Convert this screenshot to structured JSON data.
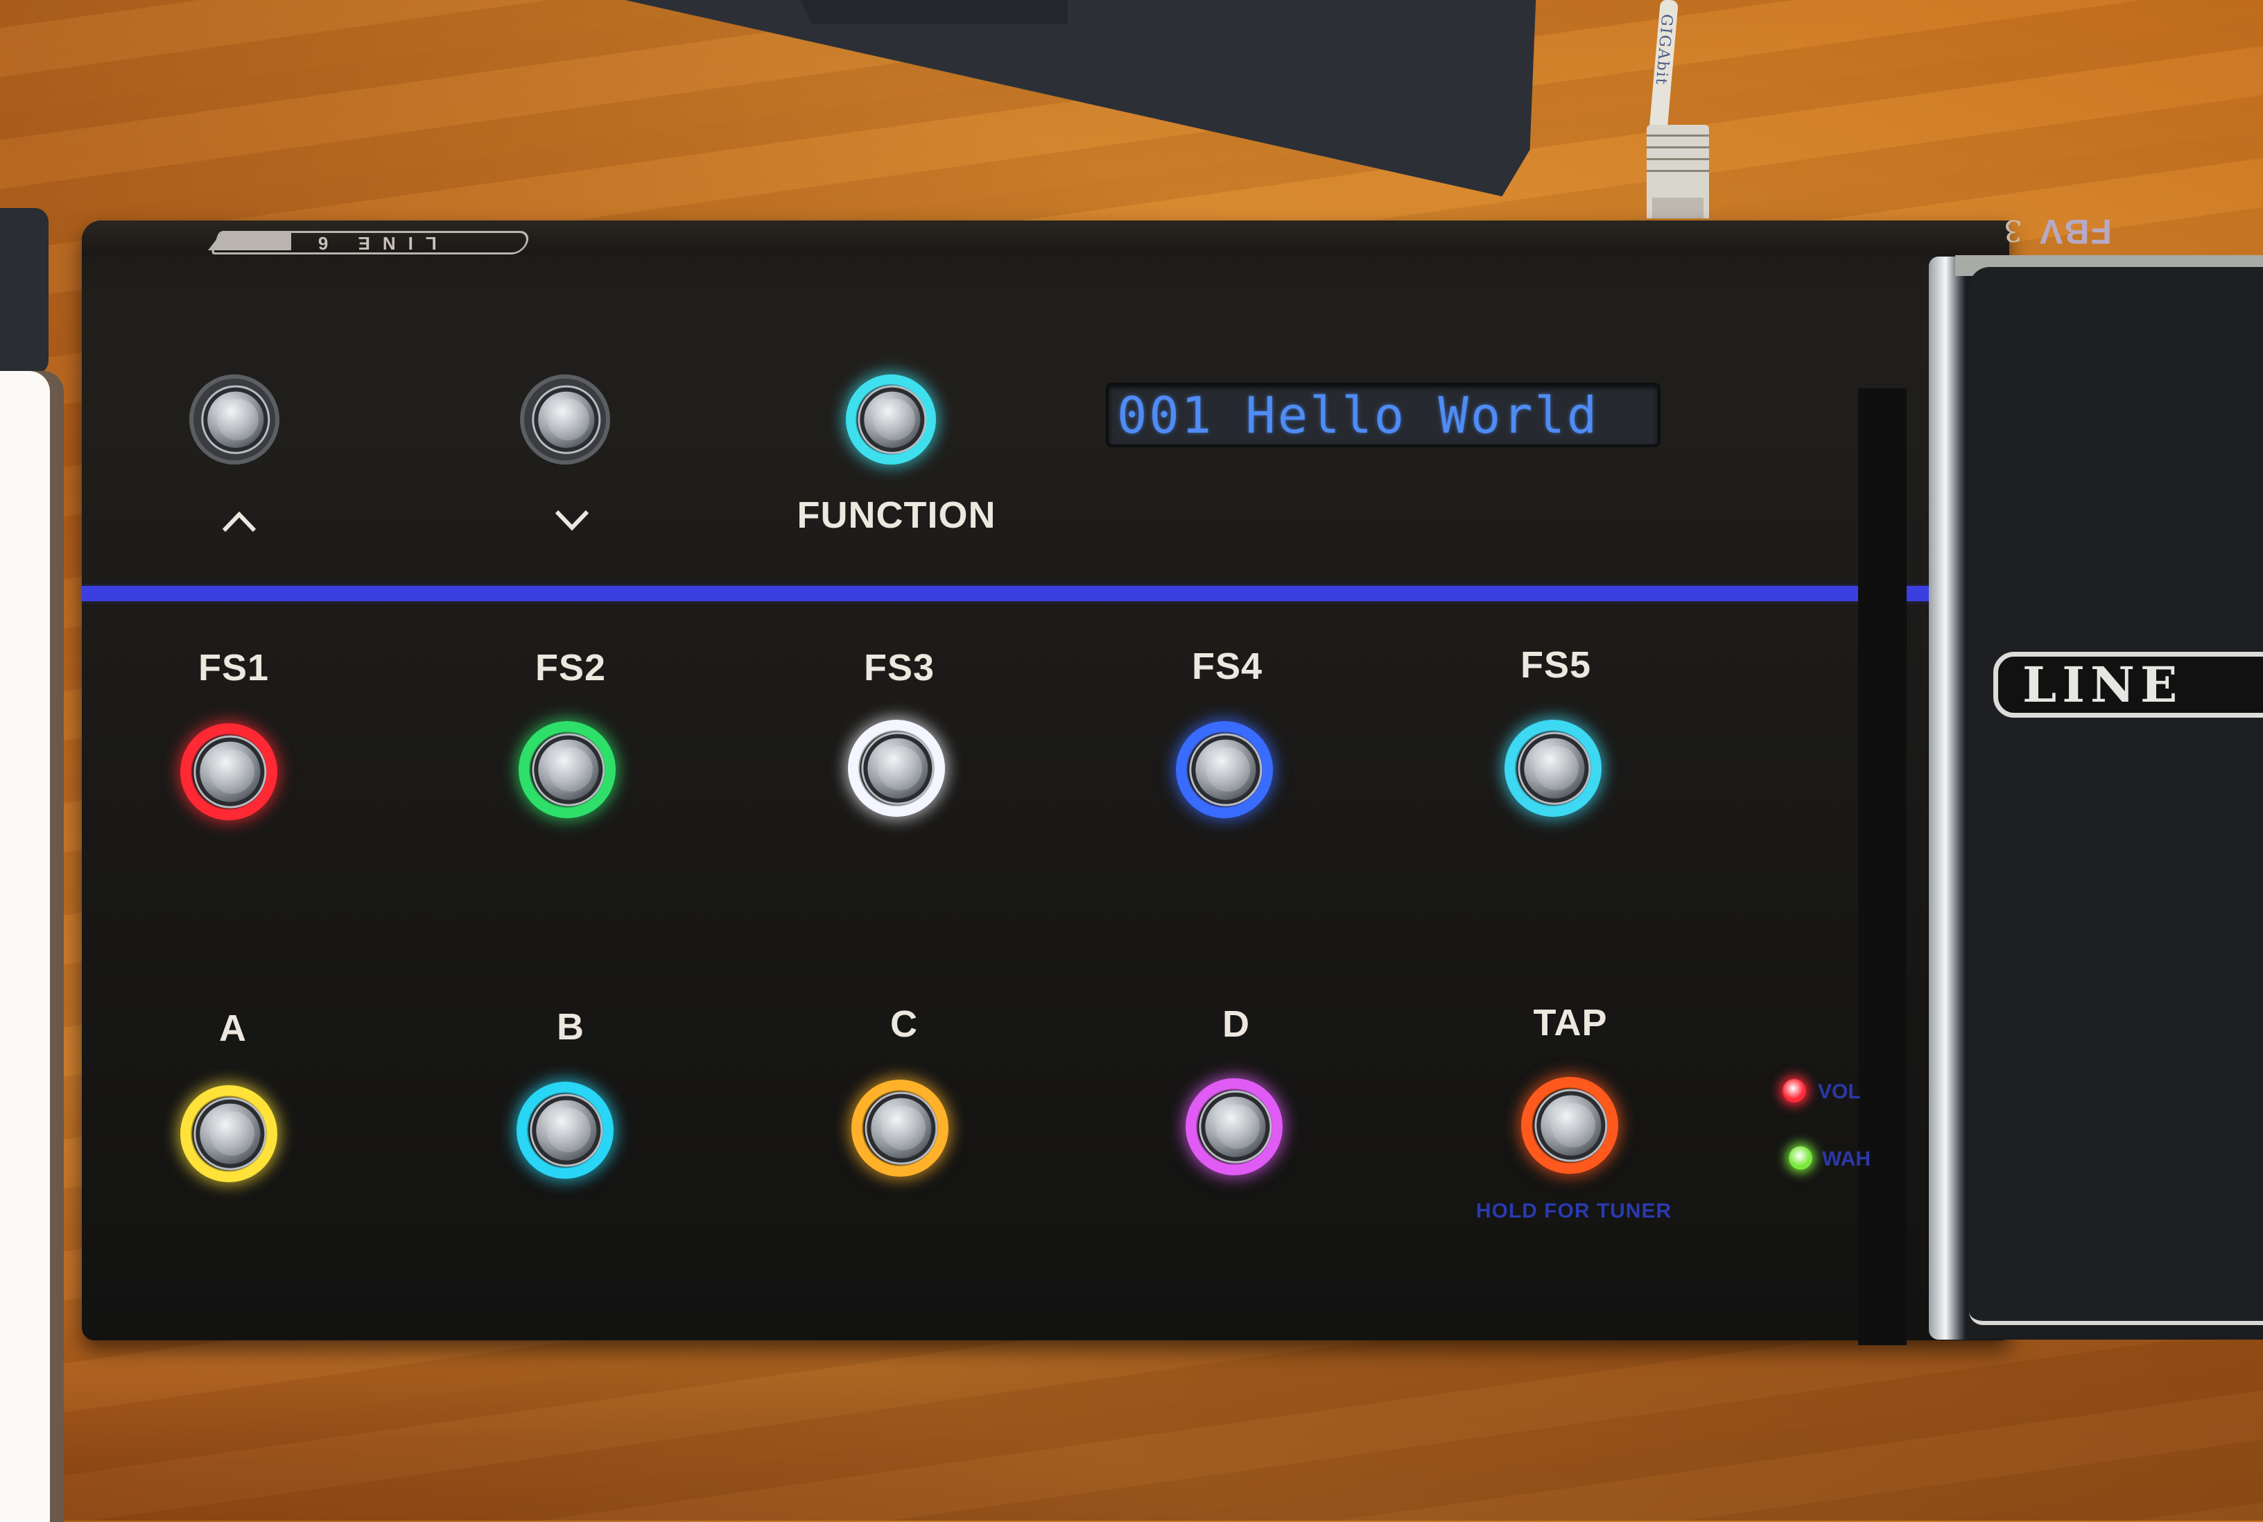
{
  "device": {
    "brand_rim_logo": "LINE 6",
    "model_rim_logo": "FBV",
    "model_rim_number": "3",
    "pedal_logo": "LINE",
    "accent_line_color": "#3b3fe0"
  },
  "display": {
    "text": "001 Hello World",
    "text_color": "#4f8cf5"
  },
  "top_controls": [
    {
      "id": "up",
      "label": "^",
      "icon": "chevron-up-icon",
      "lit": false,
      "color": null
    },
    {
      "id": "down",
      "label": "v",
      "icon": "chevron-down-icon",
      "lit": false,
      "color": null
    },
    {
      "id": "function",
      "label": "FUNCTION",
      "lit": true,
      "color": "#3fe0ee"
    }
  ],
  "footswitches_row1": [
    {
      "label": "FS1",
      "color": "#ff2a35"
    },
    {
      "label": "FS2",
      "color": "#2fe06a"
    },
    {
      "label": "FS3",
      "color": "#f4f6ff"
    },
    {
      "label": "FS4",
      "color": "#3a6cff"
    },
    {
      "label": "FS5",
      "color": "#3ed8f2"
    }
  ],
  "footswitches_row2": [
    {
      "label": "A",
      "color": "#ffe23a"
    },
    {
      "label": "B",
      "color": "#2ad6f5"
    },
    {
      "label": "C",
      "color": "#ffb22a"
    },
    {
      "label": "D",
      "color": "#e05cf5"
    },
    {
      "label": "TAP",
      "color": "#ff5a1e",
      "sub_label": "HOLD FOR TUNER"
    }
  ],
  "indicators": [
    {
      "label": "VOL",
      "state": "on",
      "color": "#ff2a3a"
    },
    {
      "label": "WAH",
      "state": "on",
      "color": "#7ae83a"
    }
  ],
  "background": {
    "cable_label": "GIGAbit"
  }
}
